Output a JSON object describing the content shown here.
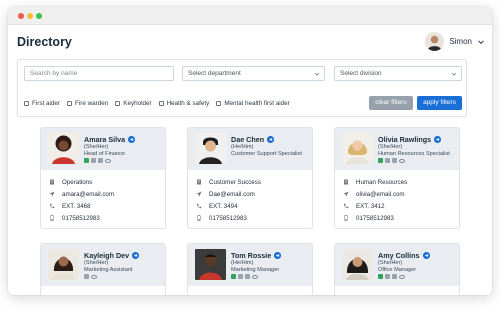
{
  "page": {
    "title": "Directory"
  },
  "user": {
    "name": "Simon"
  },
  "filters": {
    "search_placeholder": "Search by name",
    "department_label": "Select department",
    "division_label": "Select division",
    "checkboxes": [
      "First aider",
      "Fire warden",
      "Keyholder",
      "Health & safety",
      "Mental health first aider"
    ],
    "clear_label": "clear filters",
    "apply_label": "apply filters"
  },
  "people": [
    {
      "name": "Amara Silva",
      "pronouns": "(She/Her)",
      "title": "Head of Finance",
      "department": "Operations",
      "email": "amara@email.com",
      "ext": "EXT. 3468",
      "phone": "01758512983"
    },
    {
      "name": "Dae Chen",
      "pronouns": "(He/Him)",
      "title": "Customer Support Specialist",
      "department": "Customer Success",
      "email": "Dae@email.com",
      "ext": "EXT. 3494",
      "phone": "01758512983"
    },
    {
      "name": "Olivia Rawlings",
      "pronouns": "(She/Her)",
      "title": "Human Resources Specialist",
      "department": "Human Resources",
      "email": "olivia@email.com",
      "ext": "EXT. 3412",
      "phone": "01758512983"
    },
    {
      "name": "Kayleigh Dev",
      "pronouns": "(She/Her)",
      "title": "Marketing Assistant"
    },
    {
      "name": "Tom Rossie",
      "pronouns": "(He/Him)",
      "title": "Marketing Manager"
    },
    {
      "name": "Amy Collins",
      "pronouns": "(She/Her)",
      "title": "Office Manager"
    }
  ],
  "colors": {
    "accent": "#1a6fd6",
    "card_header": "#e9edf1",
    "badge_green": "#2fa35a",
    "clear_button": "#97a1ab"
  }
}
